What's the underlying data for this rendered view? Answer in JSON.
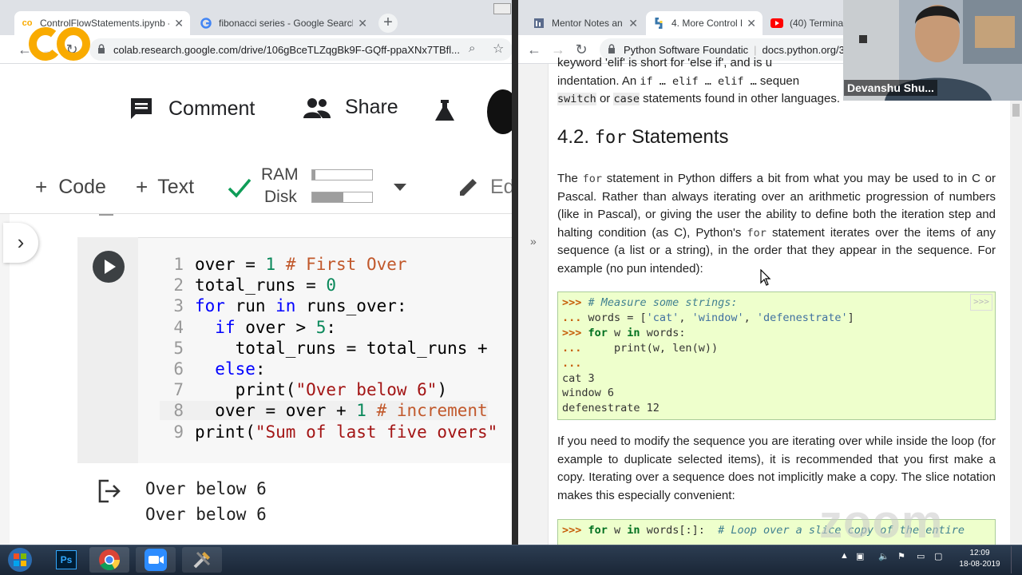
{
  "left_browser": {
    "tabs": [
      {
        "title": "ControlFlowStatements.ipynb - C",
        "active": true
      },
      {
        "title": "fibonacci series - Google Search",
        "active": false
      }
    ],
    "url": "colab.research.google.com/drive/106gBceTLZqgBk9F-GQff-ppaXNx7TBfl..."
  },
  "colab": {
    "header": {
      "comment": "Comment",
      "share": "Share"
    },
    "toolbar": {
      "code": "Code",
      "text": "Text",
      "ram": "RAM",
      "disk": "Disk",
      "edit": "Ed"
    },
    "ram_fill": 0.05,
    "disk_fill": 0.52,
    "code_lines": [
      {
        "n": "1",
        "html_key": "l1"
      },
      {
        "n": "2",
        "html_key": "l2"
      },
      {
        "n": "3",
        "html_key": "l3"
      },
      {
        "n": "4",
        "html_key": "l4"
      },
      {
        "n": "5",
        "html_key": "l5"
      },
      {
        "n": "6",
        "html_key": "l6"
      },
      {
        "n": "7",
        "html_key": "l7"
      },
      {
        "n": "8",
        "html_key": "l8"
      },
      {
        "n": "9",
        "html_key": "l9"
      }
    ],
    "code": {
      "l1": "over = 1 # First Over",
      "l2": "total_runs = 0",
      "l3": "for run in runs_over:",
      "l4": "  if over > 5:",
      "l5": "    total_runs = total_runs +",
      "l6": "  else:",
      "l7": "    print(\"Over below 6\")",
      "l8": "  over = over + 1 # increment",
      "l9": "print(\"Sum of last five overs\""
    },
    "output": [
      "Over below 6",
      "Over below 6"
    ]
  },
  "right_browser": {
    "tabs": [
      {
        "title": "Mentor Notes an",
        "active": false
      },
      {
        "title": "4. More Control F",
        "active": true
      },
      {
        "title": "(40) Terminal",
        "active": false
      }
    ],
    "site": "Python Software Foundatic",
    "url": "docs.python.org/3"
  },
  "doc": {
    "intro_line1": "keyword 'elif' is short for 'else if', and is u",
    "intro_line2_a": "indentation. An ",
    "intro_line2_code": "if … elif … elif …",
    "intro_line2_b": " sequen",
    "intro_line3_code1": "switch",
    "intro_line3_a": " or ",
    "intro_line3_code2": "case",
    "intro_line3_b": " statements found in other languages.",
    "heading_num": "4.2. ",
    "heading_code": "for",
    "heading_text": " Statements",
    "p1_a": "The ",
    "p1_code": "for",
    "p1_b": " statement in Python differs a bit from what you may be used to in C or Pascal. Rather than always iterating over an arithmetic progression of numbers (like in Pascal), or giving the user the ability to define both the iteration step and halting condition (as C), Python's ",
    "p1_code2": "for",
    "p1_c": " statement iterates over the items of any sequence (a list or a string), in the order that they appear in the sequence. For example (no pun intended):",
    "example1": {
      "l1_prompt": ">>> ",
      "l1_comment": "# Measure some strings:",
      "l2_prompt": "... ",
      "l2_a": "words = [",
      "l2_s1": "'cat'",
      "l2_s2": "'window'",
      "l2_s3": "'defenestrate'",
      "l3_prompt": ">>> ",
      "l3_kw1": "for",
      "l3_a": " w ",
      "l3_kw2": "in",
      "l3_b": " words:",
      "l4_prompt": "...     ",
      "l4_a": "print(w, len(w))",
      "l5_prompt": "...",
      "out": [
        "cat 3",
        "window 6",
        "defenestrate 12"
      ],
      "copy": ">>>"
    },
    "p2": "If you need to modify the sequence you are iterating over while inside the loop (for example to duplicate selected items), it is recommended that you first make a copy. Iterating over a sequence does not implicitly make a copy. The slice notation makes this especially convenient:",
    "example2": {
      "prompt": ">>> ",
      "kw1": "for",
      "a": " w ",
      "kw2": "in",
      "b": " words[:]:  ",
      "comment": "# Loop over a slice copy of the entire"
    }
  },
  "webcam": {
    "name": "Devanshu Shu..."
  },
  "watermark": "zoom",
  "taskbar": {
    "time": "12:09",
    "date": "18-08-2019",
    "ps": "Ps"
  }
}
